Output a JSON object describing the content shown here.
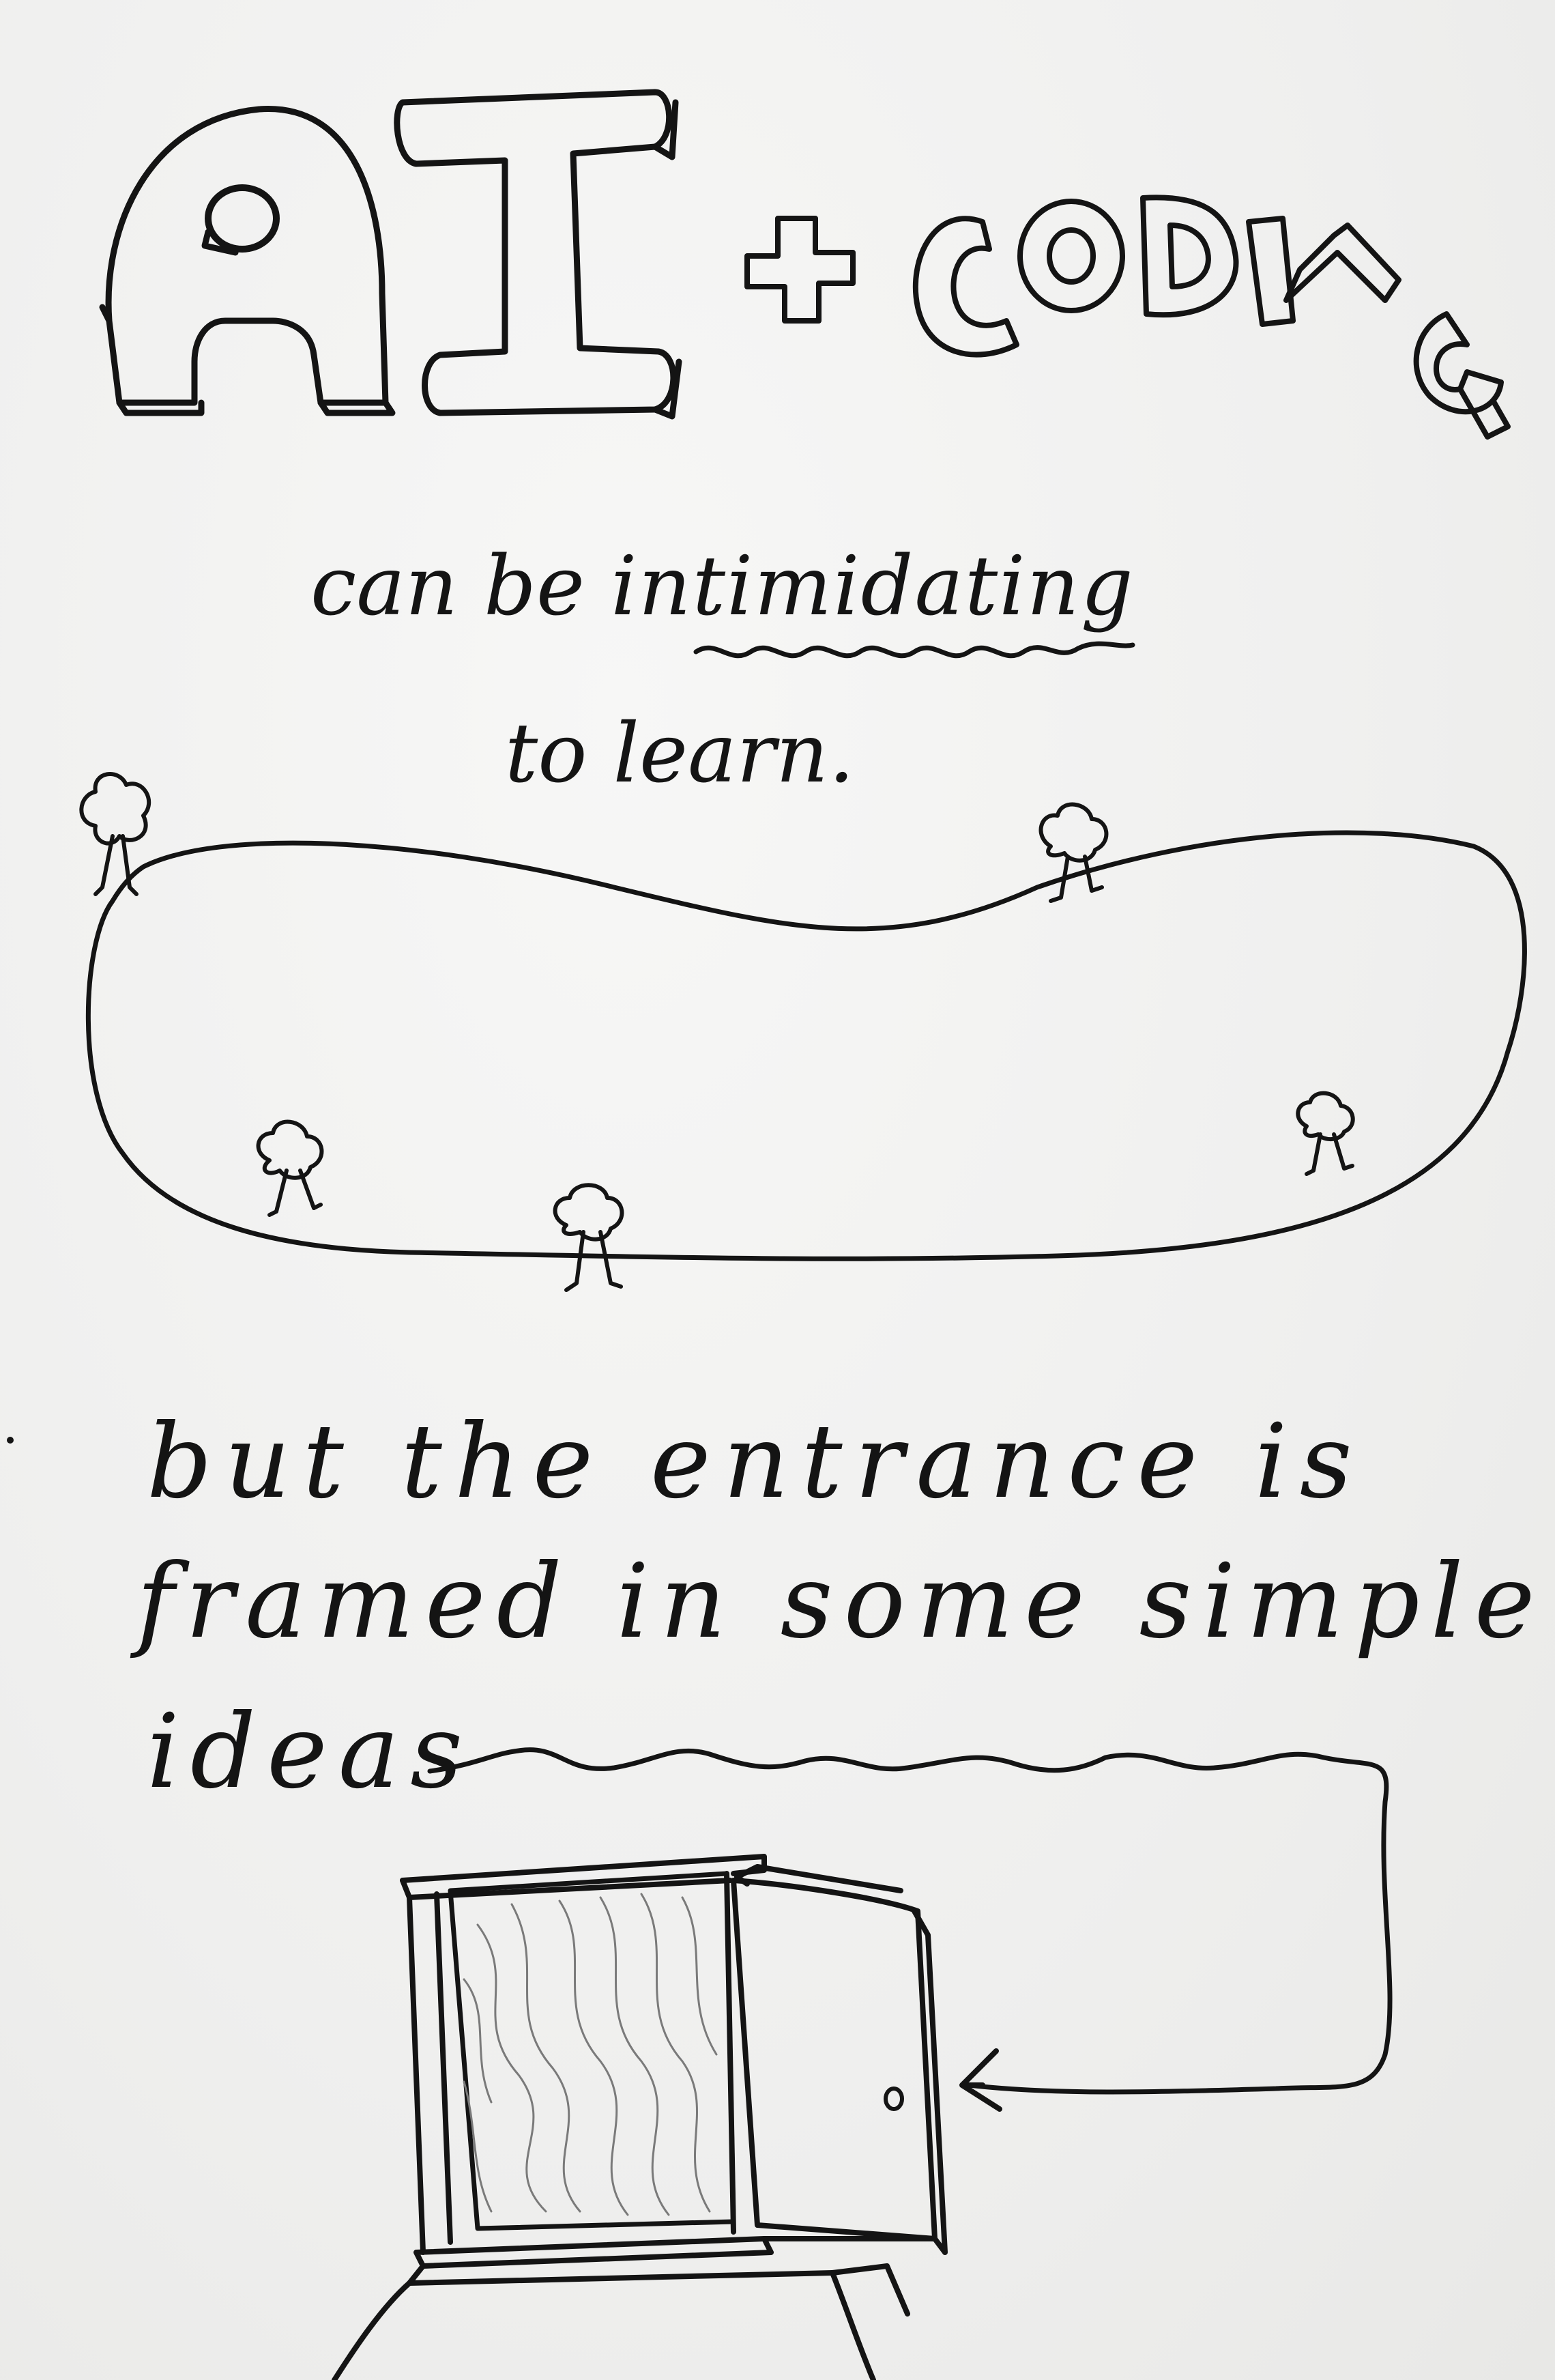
{
  "title": {
    "word_1": "AI",
    "plus": "+",
    "word_2": "CODING"
  },
  "text": {
    "line_1_prefix": "can be ",
    "line_1_emphasis": "intimidating",
    "line_2": "to learn.",
    "line_3": "but the entrance is",
    "line_4": "framed in some simple",
    "line_5": "ideas"
  },
  "colors": {
    "ink": "#141414",
    "paper": "#f1f1f0",
    "shading": "#7a7a7a"
  },
  "icons": {
    "trees": "tree-icon",
    "door": "open-door-icon",
    "arrow": "arrow-icon"
  }
}
